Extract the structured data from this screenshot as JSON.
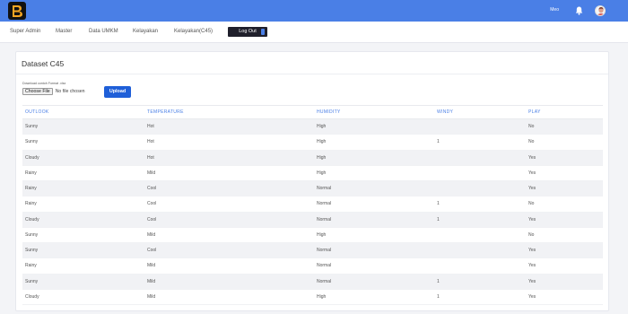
{
  "header": {
    "user_name": "Meo",
    "icons": {
      "logo": "app-logo",
      "bell": "bell-icon",
      "avatar": "user-avatar"
    },
    "accent_color": "#4a7fe6"
  },
  "nav": {
    "items": [
      "Super Admin",
      "Master",
      "Data UMKM",
      "Kelayakan",
      "Kelayakan(C45)"
    ],
    "logout_label": "Log Out"
  },
  "card": {
    "title": "Dataset C45",
    "upload_hint": "Download contoh Format .xlsx",
    "file_button_label": "Choose File",
    "file_status": "No file chosen",
    "upload_label": "Upload"
  },
  "table": {
    "headers": [
      "OUTLOOK",
      "TEMPERATURE",
      "HUMIDITY",
      "WINDY",
      "PLAY"
    ],
    "rows": [
      [
        "Sunny",
        "Hot",
        "High",
        "",
        "No"
      ],
      [
        "Sunny",
        "Hot",
        "High",
        "1",
        "No"
      ],
      [
        "Cloudy",
        "Hot",
        "High",
        "",
        "Yes"
      ],
      [
        "Rainy",
        "Mild",
        "High",
        "",
        "Yes"
      ],
      [
        "Rainy",
        "Cool",
        "Normal",
        "",
        "Yes"
      ],
      [
        "Rainy",
        "Cool",
        "Normal",
        "1",
        "No"
      ],
      [
        "Cloudy",
        "Cool",
        "Normal",
        "1",
        "Yes"
      ],
      [
        "Sunny",
        "Mild",
        "High",
        "",
        "No"
      ],
      [
        "Sunny",
        "Cool",
        "Normal",
        "",
        "Yes"
      ],
      [
        "Rainy",
        "Mild",
        "Normal",
        "",
        "Yes"
      ],
      [
        "Sunny",
        "Mild",
        "Normal",
        "1",
        "Yes"
      ],
      [
        "Cloudy",
        "Mild",
        "High",
        "1",
        "Yes"
      ]
    ]
  }
}
